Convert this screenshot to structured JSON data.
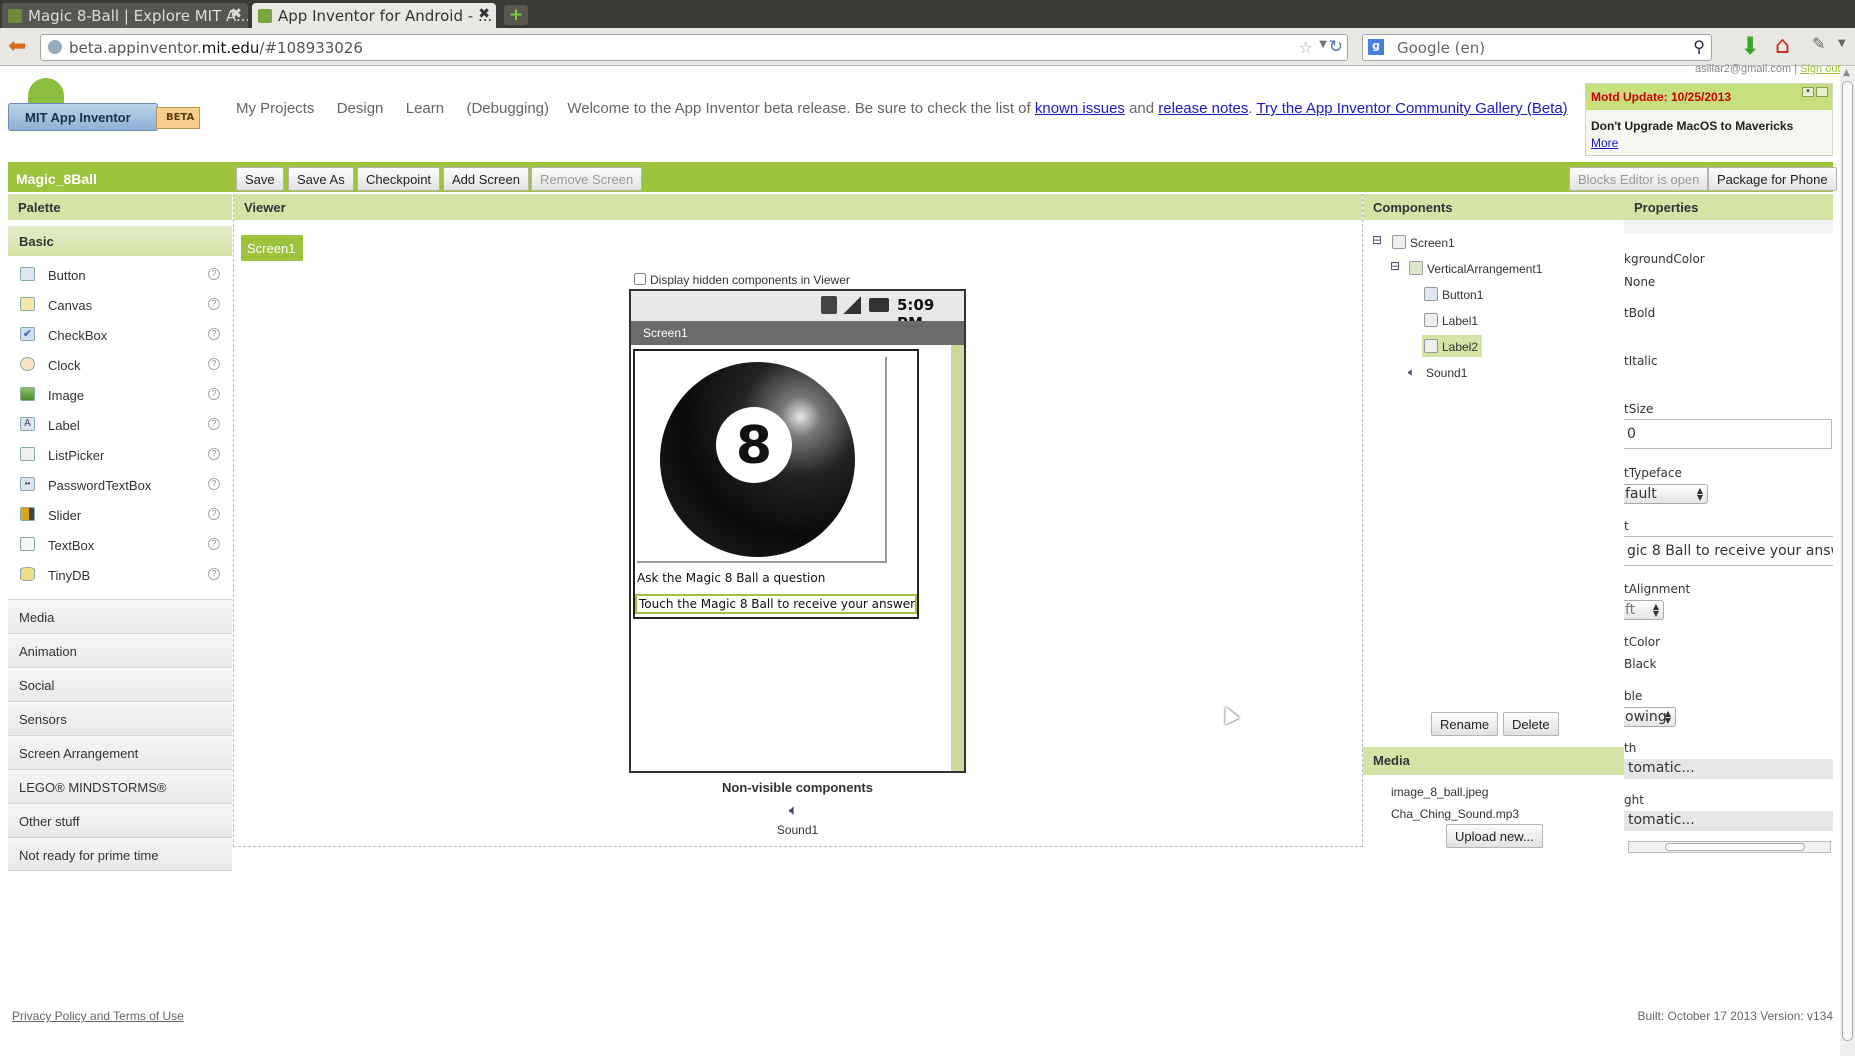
{
  "browser": {
    "tabs": [
      {
        "title": "Magic 8-Ball | Explore MIT A...",
        "active": false
      },
      {
        "title": "App Inventor for Android - ...",
        "active": true
      }
    ],
    "url_prefix": "beta.appinventor.",
    "url_domain": "mit.edu",
    "url_path": "/#108933026",
    "search_placeholder": "Google (en)"
  },
  "header": {
    "logo_text": "MIT App Inventor",
    "logo_badge": "BETA",
    "nav": [
      "My Projects",
      "Design",
      "Learn",
      "(Debugging)"
    ],
    "welcome_text": "Welcome to the App Inventor beta release. Be sure to check the list of",
    "known_issues": "known issues",
    "and_text": "and",
    "release_notes": "release notes",
    "period": ".",
    "gallery_link": "Try the App Inventor Community Gallery (Beta)",
    "user_email": "asillar2@gmail.com",
    "separator": "|",
    "sign_out": "Sign out"
  },
  "motd": {
    "title": "Motd Update: 10/25/2013",
    "message": "Don't Upgrade MacOS to Mavericks",
    "more": "More"
  },
  "toolbar": {
    "project_name": "Magic_8Ball",
    "save": "Save",
    "save_as": "Save As",
    "checkpoint": "Checkpoint",
    "add_screen": "Add Screen",
    "remove_screen": "Remove Screen",
    "blocks_editor": "Blocks Editor is open",
    "package": "Package for Phone"
  },
  "palette": {
    "title": "Palette",
    "section": "Basic",
    "items": [
      "Button",
      "Canvas",
      "CheckBox",
      "Clock",
      "Image",
      "Label",
      "ListPicker",
      "PasswordTextBox",
      "Slider",
      "TextBox",
      "TinyDB"
    ],
    "help": "?",
    "drawers": [
      "Media",
      "Animation",
      "Social",
      "Sensors",
      "Screen Arrangement",
      "LEGO® MINDSTORMS®",
      "Other stuff",
      "Not ready for prime time"
    ]
  },
  "viewer": {
    "title": "Viewer",
    "screen_button": "Screen1",
    "hidden_checkbox": "Display hidden components in Viewer",
    "status_time": "5:09 PM",
    "screen_title": "Screen1",
    "ball_number": "8",
    "label1": "Ask the Magic 8 Ball a question",
    "label2": "Touch the Magic 8 Ball to receive your answer",
    "nonvisible_title": "Non-visible components",
    "nonvisible_item": "Sound1"
  },
  "components": {
    "title": "Components",
    "tree": [
      "Screen1",
      "VerticalArrangement1",
      "Button1",
      "Label1",
      "Label2",
      "Sound1"
    ],
    "collapse_glyph": "⊟",
    "rename": "Rename",
    "delete": "Delete"
  },
  "media": {
    "title": "Media",
    "files": [
      "image_8_ball.jpeg",
      "Cha_Ching_Sound.mp3"
    ],
    "upload": "Upload new..."
  },
  "properties": {
    "title": "Properties",
    "labels": [
      "kgroundColor",
      "tBold",
      "tItalic",
      "tSize",
      "tTypeface",
      "t",
      "tAlignment",
      "tColor",
      "ble",
      "th",
      "ght"
    ],
    "bg_value": "None",
    "size_value": "0",
    "typeface_value": "fault",
    "text_value": "gic 8 Ball to receive your answer",
    "alignment_value": "ft",
    "color_value": "Black",
    "visible_value": "owing",
    "width_value": "tomatic...",
    "height_value": "tomatic..."
  },
  "footer": {
    "privacy": "Privacy Policy and Terms of Use",
    "built": "Built: October 17 2013 Version: v134"
  },
  "colors": {
    "accent": "#9ec33c",
    "header_light": "#d4e3a6",
    "motd_red": "#cc0000"
  }
}
